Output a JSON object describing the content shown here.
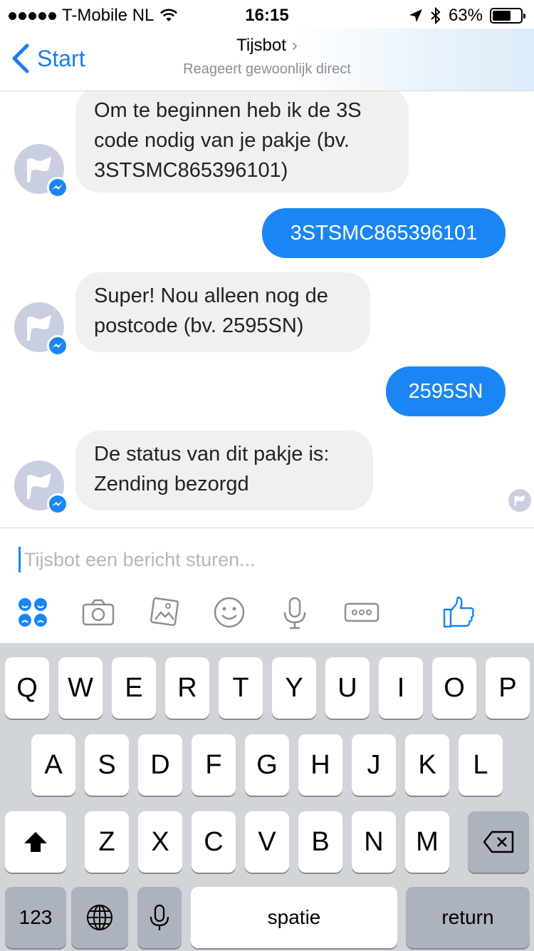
{
  "status_bar": {
    "carrier": "T-Mobile NL",
    "time": "16:15",
    "battery": "63%"
  },
  "nav": {
    "back_label": "Start",
    "title": "Tijsbot",
    "subtitle": "Reageert gewoonlijk direct"
  },
  "messages": [
    {
      "direction": "incoming",
      "text_lines": [
        "Om te beginnen heb ik de 3S",
        "code nodig van je pakje (bv.",
        "3STSMC865396101)"
      ]
    },
    {
      "direction": "outgoing",
      "text": "3STSMC865396101"
    },
    {
      "direction": "incoming",
      "text_lines": [
        "Super! Nou alleen nog de",
        "postcode (bv. 2595SN)"
      ]
    },
    {
      "direction": "outgoing",
      "text": "2595SN"
    },
    {
      "direction": "incoming",
      "text_lines": [
        "De status van dit pakje is:",
        "Zending bezorgd"
      ]
    }
  ],
  "composer": {
    "placeholder": "Tijsbot een bericht sturen...",
    "value": "",
    "tools": [
      "quick-replies-icon",
      "camera-icon",
      "gallery-icon",
      "emoji-icon",
      "microphone-icon",
      "more-icon",
      "thumbs-up-icon"
    ],
    "accent_color": "#1b86f3"
  },
  "keyboard": {
    "row1": [
      "Q",
      "W",
      "E",
      "R",
      "T",
      "Y",
      "U",
      "I",
      "O",
      "P"
    ],
    "row2": [
      "A",
      "S",
      "D",
      "F",
      "G",
      "H",
      "J",
      "K",
      "L"
    ],
    "row3": [
      "Z",
      "X",
      "C",
      "V",
      "B",
      "N",
      "M"
    ],
    "numbers_label": "123",
    "space_label": "spatie",
    "return_label": "return"
  }
}
